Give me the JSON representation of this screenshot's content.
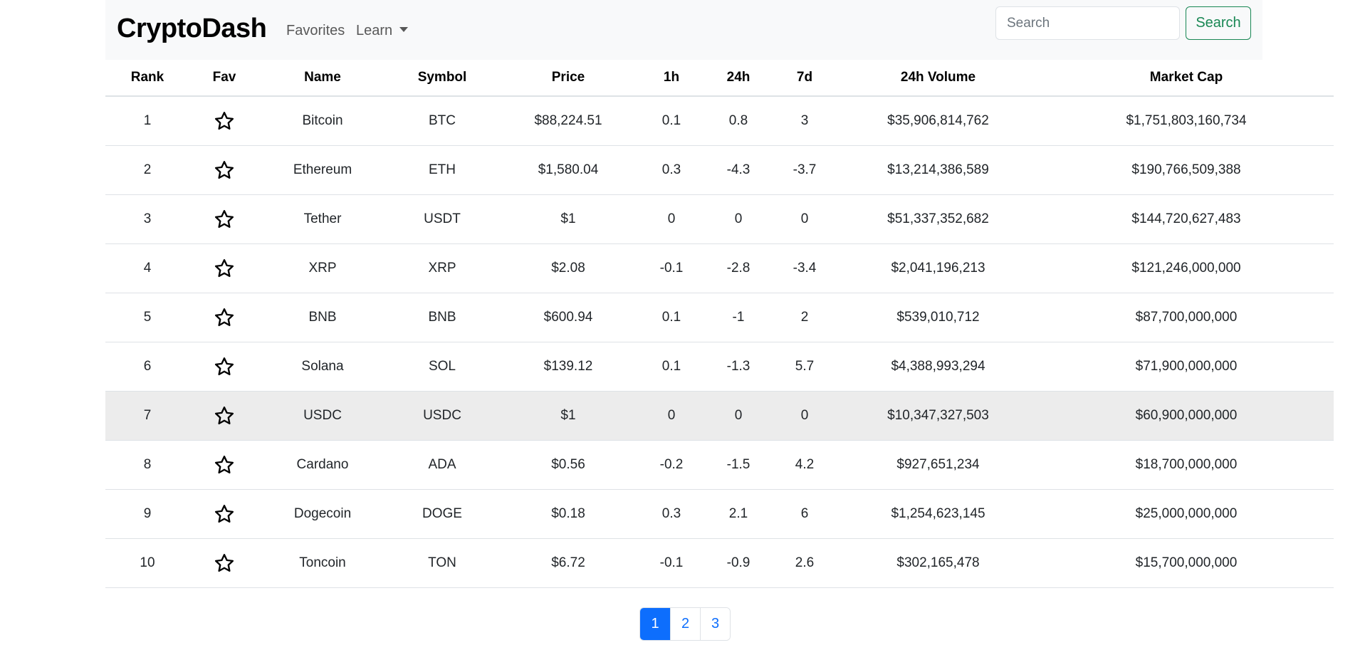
{
  "navbar": {
    "brand": "CryptoDash",
    "links": {
      "favorites": "Favorites",
      "learn": "Learn"
    },
    "search_placeholder": "Search",
    "search_button": "Search"
  },
  "table": {
    "headers": [
      "Rank",
      "Fav",
      "Name",
      "Symbol",
      "Price",
      "1h",
      "24h",
      "7d",
      "24h Volume",
      "Market Cap"
    ],
    "rows": [
      {
        "rank": "1",
        "name": "Bitcoin",
        "symbol": "BTC",
        "price": "$88,224.51",
        "h1": "0.1",
        "h24": "0.8",
        "d7": "3",
        "volume": "$35,906,814,762",
        "mcap": "$1,751,803,160,734"
      },
      {
        "rank": "2",
        "name": "Ethereum",
        "symbol": "ETH",
        "price": "$1,580.04",
        "h1": "0.3",
        "h24": "-4.3",
        "d7": "-3.7",
        "volume": "$13,214,386,589",
        "mcap": "$190,766,509,388"
      },
      {
        "rank": "3",
        "name": "Tether",
        "symbol": "USDT",
        "price": "$1",
        "h1": "0",
        "h24": "0",
        "d7": "0",
        "volume": "$51,337,352,682",
        "mcap": "$144,720,627,483"
      },
      {
        "rank": "4",
        "name": "XRP",
        "symbol": "XRP",
        "price": "$2.08",
        "h1": "-0.1",
        "h24": "-2.8",
        "d7": "-3.4",
        "volume": "$2,041,196,213",
        "mcap": "$121,246,000,000"
      },
      {
        "rank": "5",
        "name": "BNB",
        "symbol": "BNB",
        "price": "$600.94",
        "h1": "0.1",
        "h24": "-1",
        "d7": "2",
        "volume": "$539,010,712",
        "mcap": "$87,700,000,000"
      },
      {
        "rank": "6",
        "name": "Solana",
        "symbol": "SOL",
        "price": "$139.12",
        "h1": "0.1",
        "h24": "-1.3",
        "d7": "5.7",
        "volume": "$4,388,993,294",
        "mcap": "$71,900,000,000"
      },
      {
        "rank": "7",
        "name": "USDC",
        "symbol": "USDC",
        "price": "$1",
        "h1": "0",
        "h24": "0",
        "d7": "0",
        "volume": "$10,347,327,503",
        "mcap": "$60,900,000,000"
      },
      {
        "rank": "8",
        "name": "Cardano",
        "symbol": "ADA",
        "price": "$0.56",
        "h1": "-0.2",
        "h24": "-1.5",
        "d7": "4.2",
        "volume": "$927,651,234",
        "mcap": "$18,700,000,000"
      },
      {
        "rank": "9",
        "name": "Dogecoin",
        "symbol": "DOGE",
        "price": "$0.18",
        "h1": "0.3",
        "h24": "2.1",
        "d7": "6",
        "volume": "$1,254,623,145",
        "mcap": "$25,000,000,000"
      },
      {
        "rank": "10",
        "name": "Toncoin",
        "symbol": "TON",
        "price": "$6.72",
        "h1": "-0.1",
        "h24": "-0.9",
        "d7": "2.6",
        "volume": "$302,165,478",
        "mcap": "$15,700,000,000"
      }
    ],
    "hovered_row_index": 6,
    "fav_icon": "star-outline-icon"
  },
  "pagination": {
    "pages": [
      "1",
      "2",
      "3"
    ],
    "active_index": 0
  },
  "colors": {
    "navbar_bg": "#f8f9fa",
    "success": "#198754",
    "primary": "#0d6efd",
    "hover_row": "#ececec"
  }
}
